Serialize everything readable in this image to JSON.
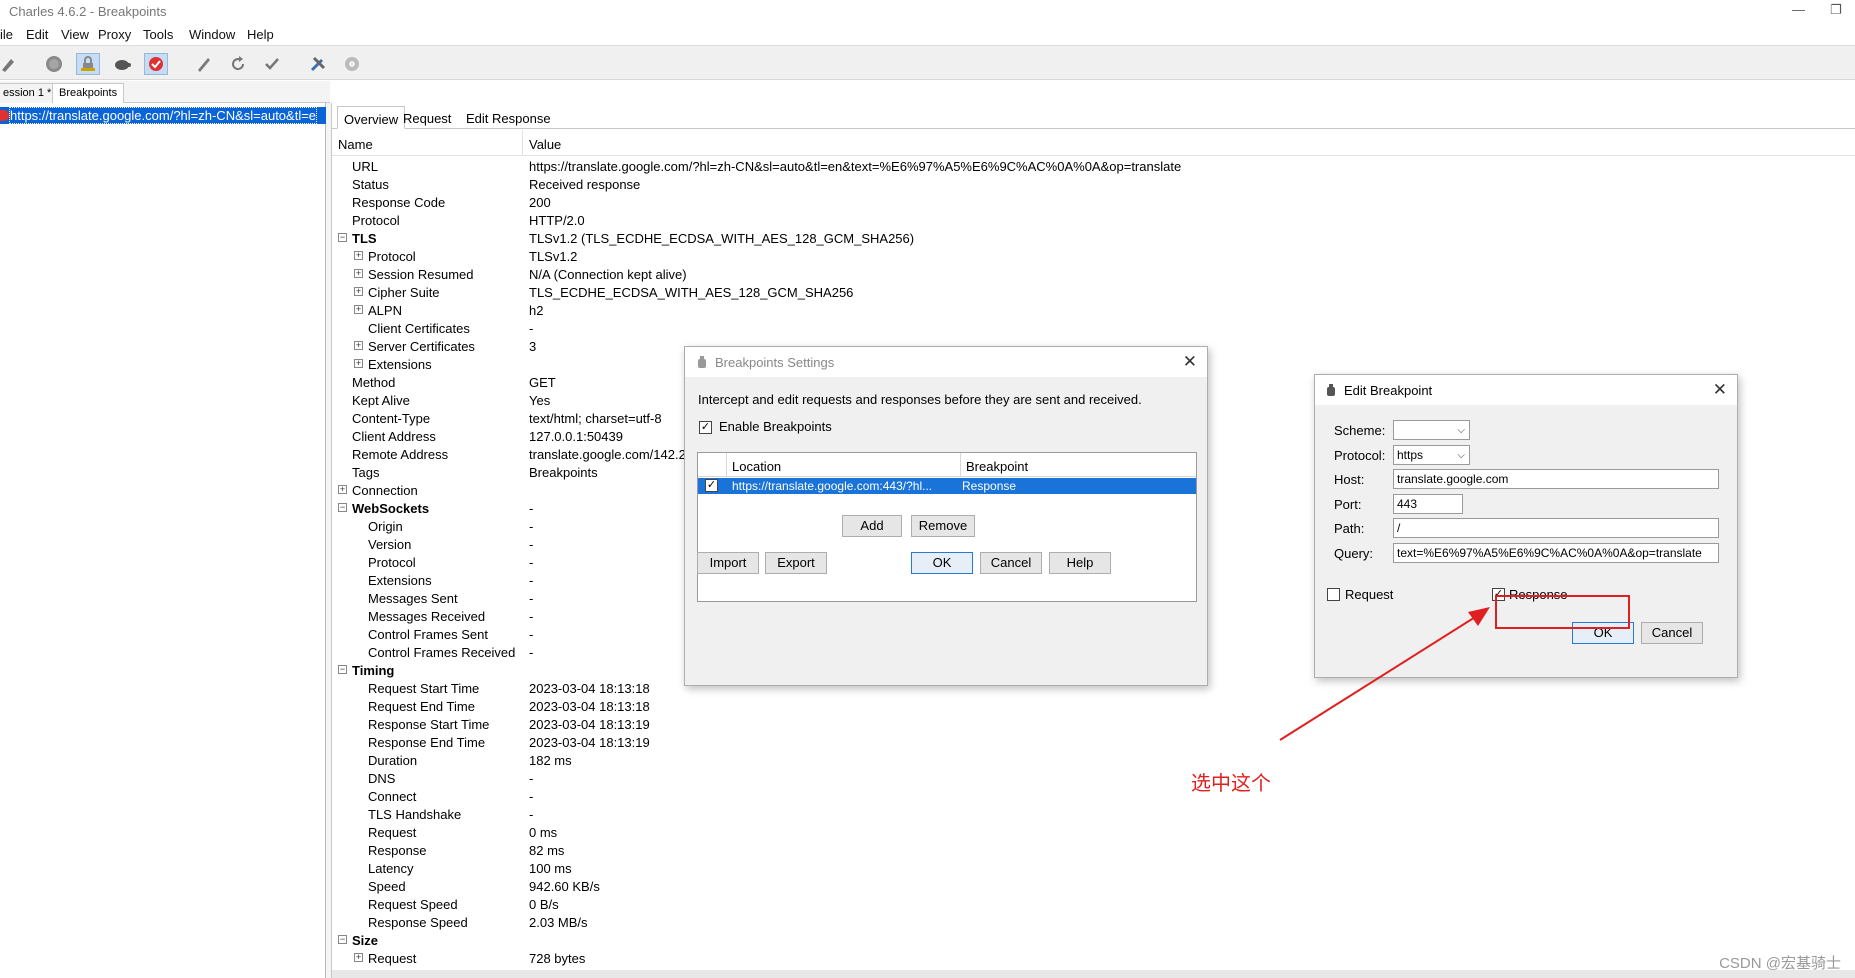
{
  "window": {
    "title": "Charles 4.6.2 - Breakpoints"
  },
  "menu": [
    "ile",
    "Edit",
    "View",
    "Proxy",
    "Tools",
    "Window",
    "Help"
  ],
  "session_tabs": [
    "ession 1 *",
    "Breakpoints"
  ],
  "left_list": {
    "item": "https://translate.google.com/?hl=zh-CN&sl=auto&tl=e"
  },
  "detail_tabs": [
    "Overview",
    "Request",
    "Edit Response"
  ],
  "overview": {
    "col_name": "Name",
    "col_value": "Value",
    "rows": [
      {
        "name": "URL",
        "value": "https://translate.google.com/?hl=zh-CN&sl=auto&tl=en&text=%E6%97%A5%E6%9C%AC%0A%0A&op=translate",
        "level": 0,
        "toggle": ""
      },
      {
        "name": "Status",
        "value": "Received response",
        "level": 0,
        "toggle": ""
      },
      {
        "name": "Response Code",
        "value": "200",
        "level": 0,
        "toggle": ""
      },
      {
        "name": "Protocol",
        "value": "HTTP/2.0",
        "level": 0,
        "toggle": ""
      },
      {
        "name": "TLS",
        "value": "TLSv1.2 (TLS_ECDHE_ECDSA_WITH_AES_128_GCM_SHA256)",
        "level": 0,
        "toggle": "−",
        "bold": true
      },
      {
        "name": "Protocol",
        "value": "TLSv1.2",
        "level": 1,
        "toggle": "+"
      },
      {
        "name": "Session Resumed",
        "value": "N/A (Connection kept alive)",
        "level": 1,
        "toggle": "+"
      },
      {
        "name": "Cipher Suite",
        "value": "TLS_ECDHE_ECDSA_WITH_AES_128_GCM_SHA256",
        "level": 1,
        "toggle": "+"
      },
      {
        "name": "ALPN",
        "value": "h2",
        "level": 1,
        "toggle": "+"
      },
      {
        "name": "Client Certificates",
        "value": "-",
        "level": 1,
        "toggle": ""
      },
      {
        "name": "Server Certificates",
        "value": "3",
        "level": 1,
        "toggle": "+"
      },
      {
        "name": "Extensions",
        "value": "",
        "level": 1,
        "toggle": "+"
      },
      {
        "name": "Method",
        "value": "GET",
        "level": 0,
        "toggle": ""
      },
      {
        "name": "Kept Alive",
        "value": "Yes",
        "level": 0,
        "toggle": ""
      },
      {
        "name": "Content-Type",
        "value": "text/html; charset=utf-8",
        "level": 0,
        "toggle": ""
      },
      {
        "name": "Client Address",
        "value": "127.0.0.1:50439",
        "level": 0,
        "toggle": ""
      },
      {
        "name": "Remote Address",
        "value": "translate.google.com/142.2",
        "level": 0,
        "toggle": ""
      },
      {
        "name": "Tags",
        "value": "Breakpoints",
        "level": 0,
        "toggle": ""
      },
      {
        "name": "Connection",
        "value": "",
        "level": 0,
        "toggle": "+"
      },
      {
        "name": "WebSockets",
        "value": "-",
        "level": 0,
        "toggle": "−",
        "bold": true
      },
      {
        "name": "Origin",
        "value": "-",
        "level": 1,
        "toggle": ""
      },
      {
        "name": "Version",
        "value": "-",
        "level": 1,
        "toggle": ""
      },
      {
        "name": "Protocol",
        "value": "-",
        "level": 1,
        "toggle": ""
      },
      {
        "name": "Extensions",
        "value": "-",
        "level": 1,
        "toggle": ""
      },
      {
        "name": "Messages Sent",
        "value": "-",
        "level": 1,
        "toggle": ""
      },
      {
        "name": "Messages Received",
        "value": "-",
        "level": 1,
        "toggle": ""
      },
      {
        "name": "Control Frames Sent",
        "value": "-",
        "level": 1,
        "toggle": ""
      },
      {
        "name": "Control Frames Received",
        "value": "-",
        "level": 1,
        "toggle": ""
      },
      {
        "name": "Timing",
        "value": "",
        "level": 0,
        "toggle": "−",
        "bold": true
      },
      {
        "name": "Request Start Time",
        "value": "2023-03-04 18:13:18",
        "level": 1,
        "toggle": ""
      },
      {
        "name": "Request End Time",
        "value": "2023-03-04 18:13:18",
        "level": 1,
        "toggle": ""
      },
      {
        "name": "Response Start Time",
        "value": "2023-03-04 18:13:19",
        "level": 1,
        "toggle": ""
      },
      {
        "name": "Response End Time",
        "value": "2023-03-04 18:13:19",
        "level": 1,
        "toggle": ""
      },
      {
        "name": "Duration",
        "value": "182 ms",
        "level": 1,
        "toggle": ""
      },
      {
        "name": "DNS",
        "value": "-",
        "level": 1,
        "toggle": ""
      },
      {
        "name": "Connect",
        "value": "-",
        "level": 1,
        "toggle": ""
      },
      {
        "name": "TLS Handshake",
        "value": "-",
        "level": 1,
        "toggle": ""
      },
      {
        "name": "Request",
        "value": "0 ms",
        "level": 1,
        "toggle": ""
      },
      {
        "name": "Response",
        "value": "82 ms",
        "level": 1,
        "toggle": ""
      },
      {
        "name": "Latency",
        "value": "100 ms",
        "level": 1,
        "toggle": ""
      },
      {
        "name": "Speed",
        "value": "942.60 KB/s",
        "level": 1,
        "toggle": ""
      },
      {
        "name": "Request Speed",
        "value": "0 B/s",
        "level": 1,
        "toggle": ""
      },
      {
        "name": "Response Speed",
        "value": "2.03 MB/s",
        "level": 1,
        "toggle": ""
      },
      {
        "name": "Size",
        "value": "",
        "level": 0,
        "toggle": "−",
        "bold": true
      },
      {
        "name": "Request",
        "value": "728 bytes",
        "level": 1,
        "toggle": "+"
      }
    ]
  },
  "breakpoints_settings": {
    "title": "Breakpoints Settings",
    "description": "Intercept and edit requests and responses before they are sent and received.",
    "enable_label": "Enable Breakpoints",
    "enable_checked": true,
    "col_location": "Location",
    "col_breakpoint": "Breakpoint",
    "entry_location": "https://translate.google.com:443/?hl...",
    "entry_breakpoint": "Response",
    "add": "Add",
    "remove": "Remove",
    "import": "Import",
    "export": "Export",
    "ok": "OK",
    "cancel": "Cancel",
    "help": "Help"
  },
  "edit_breakpoint": {
    "title": "Edit Breakpoint",
    "scheme_label": "Scheme:",
    "scheme_value": "",
    "protocol_label": "Protocol:",
    "protocol_value": "https",
    "host_label": "Host:",
    "host_value": "translate.google.com",
    "port_label": "Port:",
    "port_value": "443",
    "path_label": "Path:",
    "path_value": "/",
    "query_label": "Query:",
    "query_value": "text=%E6%97%A5%E6%9C%AC%0A%0A&op=translate",
    "request_label": "Request",
    "request_checked": false,
    "response_label": "Response",
    "response_checked": true,
    "ok": "OK",
    "cancel": "Cancel"
  },
  "annotation": {
    "text": "选中这个",
    "color": "#e02020"
  },
  "watermark": "CSDN @宏基骑士",
  "colors": {
    "selection": "#0a64d8",
    "accent_red": "#e02020"
  }
}
